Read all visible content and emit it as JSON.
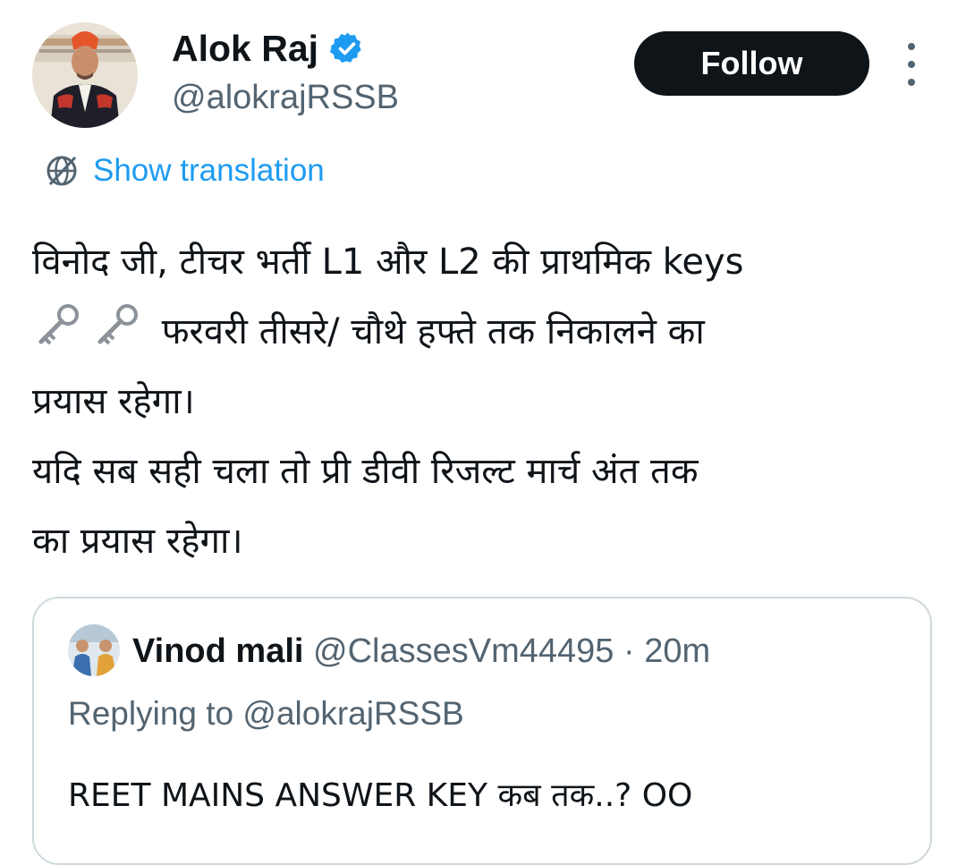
{
  "author": {
    "name": "Alok Raj",
    "handle": "@alokrajRSSB",
    "verified": true,
    "avatar_icon": "profile-photo"
  },
  "actions": {
    "follow_label": "Follow",
    "more_icon": "vertical-ellipsis-icon"
  },
  "translation": {
    "label": "Show translation",
    "icon": "globe-translate-icon"
  },
  "tweet": {
    "lines": [
      "विनोद जी, टीचर भर्ती L1 और L2 की प्राथमिक keys",
      "फरवरी तीसरे/ चौथे हफ्ते तक निकालने का",
      "प्रयास रहेगा।",
      "यदि सब सही चला तो प्री डीवी रिजल्ट मार्च अंत तक",
      "का प्रयास रहेगा।"
    ],
    "emoji": [
      "old-key-emoji",
      "old-key-emoji"
    ]
  },
  "quoted": {
    "name": "Vinod mali",
    "handle": "@ClassesVm44495",
    "separator": " · ",
    "time": "20m",
    "replying_to": "Replying to @alokrajRSSB",
    "text": "REET MAINS ANSWER KEY कब तक..? OO"
  },
  "colors": {
    "accent_blue": "#1d9bf0",
    "text_primary": "#0f1419",
    "text_secondary": "#536471",
    "border": "#cfd9de",
    "button_bg": "#0f1419"
  }
}
